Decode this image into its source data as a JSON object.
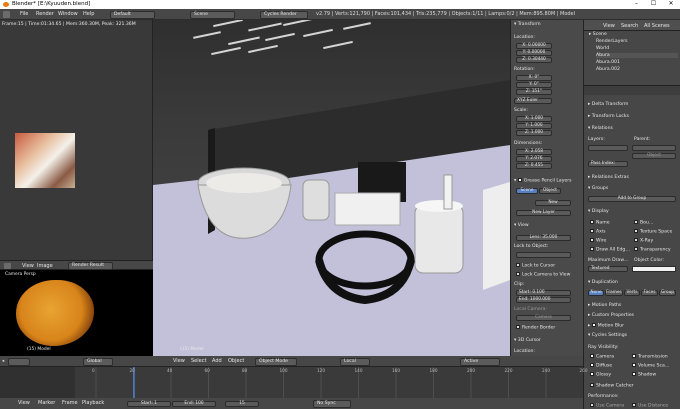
{
  "window": {
    "title": "Blender* [E:\\Kyuuden.blend]",
    "controls": [
      "–",
      "☐",
      "✕"
    ]
  },
  "menubar": {
    "items": [
      "File",
      "Render",
      "Window",
      "Help"
    ],
    "layout": "Default",
    "scene": "Scene",
    "engine": "Cycles Render",
    "stats": "v2.79 | Verts:121,790 | Faces:101,434 | Tris:235,779 | Objects:1/11 | Lamps:0/2 | Mem:895.80M | Model"
  },
  "leftview": {
    "info": "Frame:15 | Time:01:34.65 | Mem:360.30M, Peak: 321.36M"
  },
  "imageeditor": {
    "header": [
      "View",
      "Image"
    ],
    "slot": "Render Result",
    "overlay_top": "Camera Persp",
    "overlay_bottom": "(15) Model"
  },
  "viewport": {
    "overlay_bottom": "(15) Model",
    "header": [
      "View",
      "Select",
      "Add",
      "Object"
    ],
    "mode": "Object Mode",
    "orientation": "Local",
    "layer": "Active"
  },
  "npanel": {
    "transform_header": "Transform",
    "location_label": "Location:",
    "location": [
      "X:",
      "0.00000",
      "Y:",
      "0.00000",
      "Z:",
      "0.30440"
    ],
    "rotation_label": "Rotation:",
    "rotation": [
      "X:",
      "0°",
      "Y:",
      "0°",
      "Z:",
      "151°"
    ],
    "euler": "XYZ Euler",
    "scale_label": "Scale:",
    "scale": [
      "X:",
      "1.000",
      "Y:",
      "1.000",
      "Z:",
      "1.000"
    ],
    "dim_label": "Dimensions:",
    "dims": [
      "X:",
      "2.058",
      "Y:",
      "2.076",
      "Z:",
      "0.455"
    ],
    "grease_header": "Grease Pencil Layers",
    "scene_tab": "Scene",
    "object_tab": "Object",
    "new_btn": "New",
    "new_layer_btn": "New Layer",
    "view_header": "View",
    "lens": "Lens:",
    "lens_val": "35.000",
    "lock_object": "Lock to Object:",
    "lock_cursor": "Lock to Cursor",
    "lock_camera": "Lock Camera to View",
    "clip_label": "Clip:",
    "clip_start": "Start:",
    "clip_start_val": "0.100",
    "clip_end": "End:",
    "clip_end_val": "1000.000",
    "local_camera": "Local Camera:",
    "camera_field": "Camera",
    "render_border": "Render Border",
    "cursor_header": "3D Cursor",
    "cursor_loc": "Location:"
  },
  "outliner": {
    "header": [
      "View",
      "Search",
      "All Scenes"
    ],
    "items": [
      "Scene",
      "RenderLayers",
      "World",
      "Abura",
      "Abura.001",
      "Abura.002"
    ]
  },
  "properties": {
    "sections": [
      "Delta Transform",
      "Transform Locks",
      "Relations"
    ],
    "layers_label": "Layers:",
    "parent_label": "Parent:",
    "pass_index": "Pass Index:",
    "object_field": "Object",
    "relations_extras": "Relations Extras",
    "groups": "Groups",
    "add_to_group": "Add to Group",
    "display": "Display",
    "display_opts": [
      "Name",
      "Axis",
      "Wire",
      "Draw All Edg…"
    ],
    "display_opts2": [
      "Bou…",
      "Texture Space",
      "X-Ray",
      "Transparency"
    ],
    "max_draw": "Maximum Draw…",
    "object_color": "Object Color:",
    "textured": "Textured",
    "duplication": "Duplication",
    "dup_tabs": [
      "None",
      "Frames",
      "Verts",
      "Faces",
      "Group"
    ],
    "motion_paths": "Motion Paths",
    "custom_props": "Custom Properties",
    "motion_blur": "Motion Blur",
    "cycles_settings": "Cycles Settings",
    "ray_visibility": "Ray Visibility:",
    "ray_left": [
      "Camera",
      "Diffuse",
      "Glossy"
    ],
    "ray_right": [
      "Transmission",
      "Volume Sca…",
      "Shadow"
    ],
    "shadow_catcher": "Shadow Catcher",
    "performance": "Performance:",
    "use_camera": "Use Camera",
    "use_distance": "Use Distance"
  },
  "timeline": {
    "header": [
      "View",
      "Marker",
      "Frame",
      "Playback"
    ],
    "start_label": "Start:",
    "start": "1",
    "end_label": "End:",
    "end": "100",
    "frame": "15",
    "sync": "No Sync",
    "ticks": [
      "0",
      "20",
      "40",
      "60",
      "80",
      "100",
      "120",
      "140",
      "160",
      "180",
      "200",
      "220",
      "240",
      "260"
    ],
    "global": "Global"
  },
  "colors": {
    "accent": "#5680c2",
    "frame_cursor": "#4f8ff0",
    "blender_orange": "#e87d0d"
  }
}
